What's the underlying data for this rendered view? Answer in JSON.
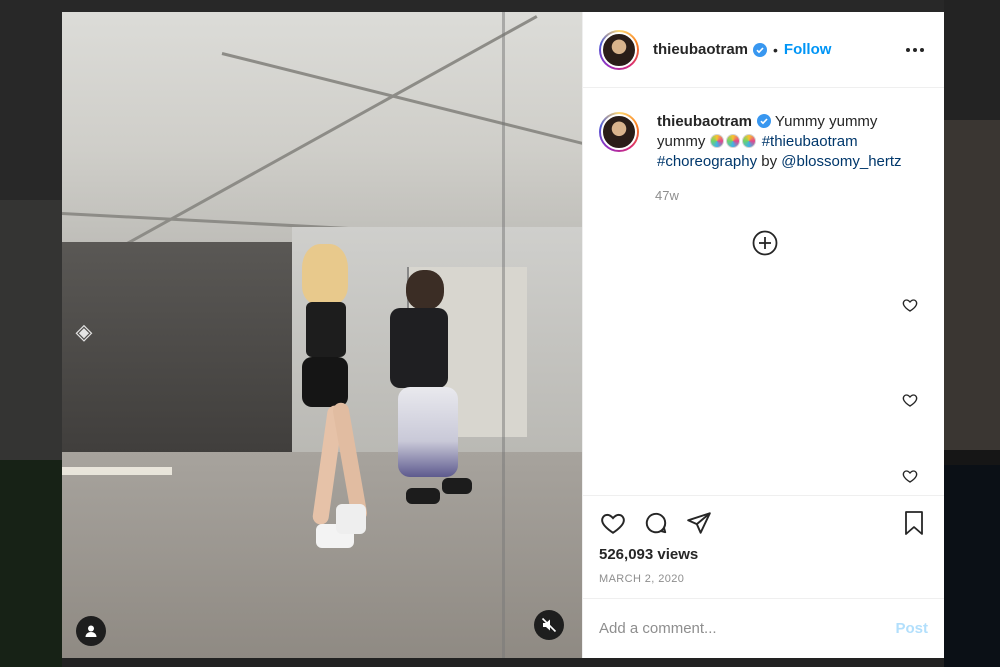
{
  "post": {
    "username": "thieubaotram",
    "separator": "•",
    "follow_label": "Follow",
    "caption_text": "Yummy yummy yummy",
    "hashtag_1": "#thieubaotram",
    "hashtag_2": "#choreography",
    "caption_by": "by",
    "mention": "@blossomy_hertz",
    "timestamp": "47w",
    "views": "526,093 views",
    "date": "MARCH 2, 2020"
  },
  "comment_box": {
    "placeholder": "Add a comment...",
    "post_label": "Post"
  },
  "colors": {
    "follow": "#0095f6",
    "hashtag": "#00376b",
    "post_disabled": "#b2dffc",
    "verified": "#3897f0"
  },
  "icons": {
    "more": "more-horizontal-icon",
    "verified": "verified-badge-icon",
    "load_more": "plus-circle-icon",
    "like": "heart-icon",
    "comment": "comment-icon",
    "share": "paper-plane-icon",
    "save": "bookmark-icon",
    "user_tag": "user-icon",
    "mute": "speaker-muted-icon"
  }
}
